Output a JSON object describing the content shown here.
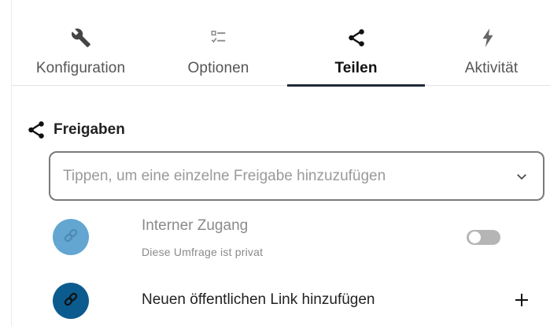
{
  "tabs": [
    {
      "label": "Konfiguration",
      "icon": "wrench-icon",
      "active": false
    },
    {
      "label": "Optionen",
      "icon": "checklist-icon",
      "active": false
    },
    {
      "label": "Teilen",
      "icon": "share-icon",
      "active": true
    },
    {
      "label": "Aktivität",
      "icon": "lightning-icon",
      "active": false
    }
  ],
  "shares": {
    "heading": "Freigaben",
    "heading_icon": "share-icon",
    "search_placeholder": "Tippen, um eine einzelne Freigabe hinzuzufügen",
    "search_value": "",
    "internal_access": {
      "title": "Interner Zugang",
      "subtitle": "Diese Umfrage ist privat",
      "icon": "link-icon",
      "toggle_on": false,
      "avatar_color": "#62a6d1"
    },
    "public_link": {
      "title": "Neuen öffentlichen Link hinzufügen",
      "icon": "link-icon",
      "add_icon": "plus-icon",
      "avatar_color": "#0c5b8f"
    }
  },
  "colors": {
    "active_tab_underline": "#1f2a37",
    "toggle_off": "#b5b5b5"
  }
}
